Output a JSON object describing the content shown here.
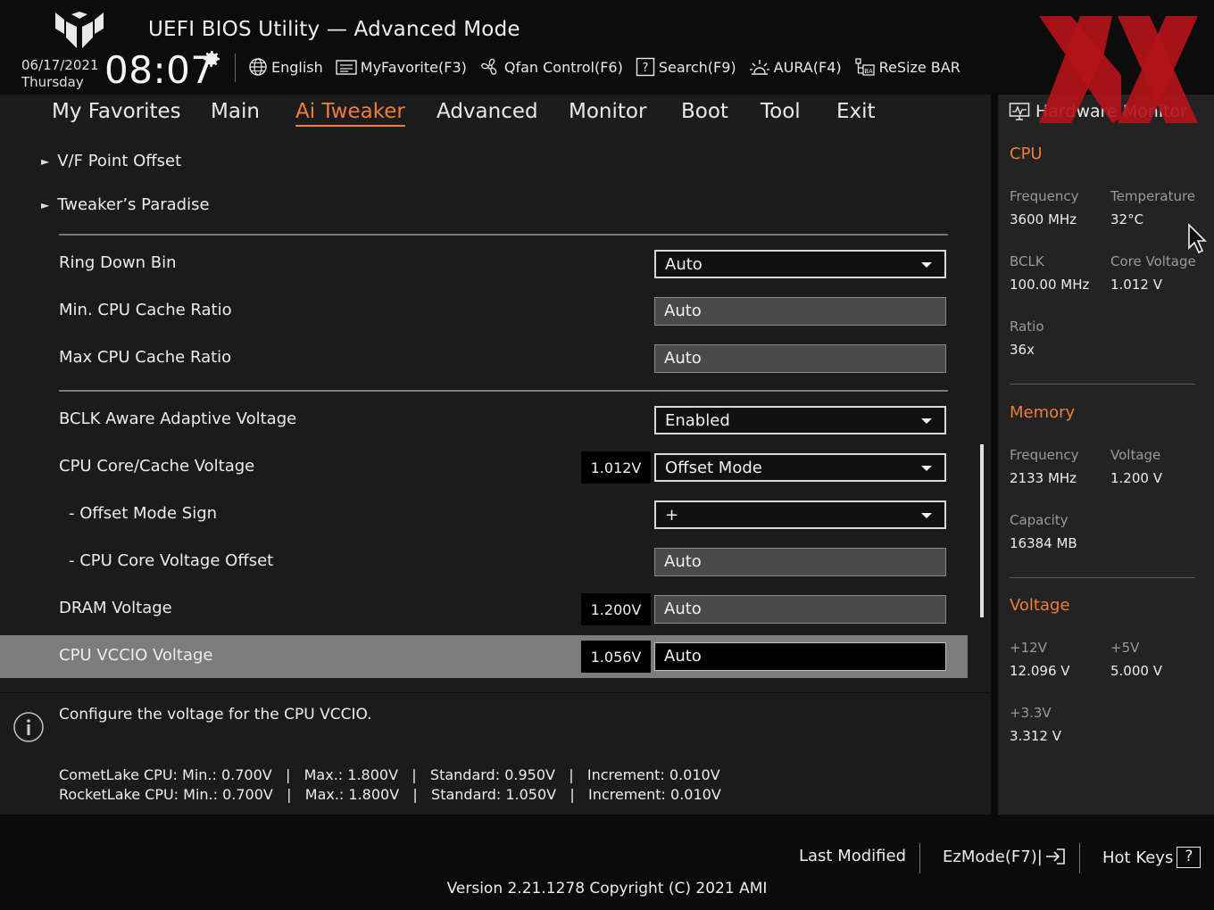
{
  "header": {
    "title": "UEFI BIOS Utility — Advanced Mode",
    "date": "06/17/2021",
    "weekday": "Thursday",
    "time": "08:07",
    "toolbar": {
      "language": "English",
      "my_favorite": "MyFavorite(F3)",
      "qfan": "Qfan Control(F6)",
      "search": "Search(F9)",
      "aura": "AURA(F4)",
      "resize_bar": "ReSize BAR"
    }
  },
  "nav": {
    "tabs": [
      "My Favorites",
      "Main",
      "Ai Tweaker",
      "Advanced",
      "Monitor",
      "Boot",
      "Tool",
      "Exit"
    ],
    "active_tab": "Ai Tweaker"
  },
  "main": {
    "submenus": [
      "V/F Point Offset",
      "Tweaker’s Paradise"
    ],
    "settings": [
      {
        "label": "Ring Down Bin",
        "value": "Auto",
        "kind": "dropdown"
      },
      {
        "label": "Min. CPU Cache Ratio",
        "value": "Auto",
        "kind": "text"
      },
      {
        "label": "Max CPU Cache Ratio",
        "value": "Auto",
        "kind": "text"
      },
      {
        "label": "BCLK Aware Adaptive Voltage",
        "value": "Enabled",
        "kind": "dropdown"
      },
      {
        "label": "CPU Core/Cache Voltage",
        "value": "Offset Mode",
        "kind": "dropdown",
        "reading": "1.012V"
      },
      {
        "label": "- Offset Mode Sign",
        "value": "+",
        "kind": "dropdown"
      },
      {
        "label": "- CPU Core Voltage Offset",
        "value": "Auto",
        "kind": "text"
      },
      {
        "label": "DRAM Voltage",
        "value": "Auto",
        "kind": "text",
        "reading": "1.200V"
      },
      {
        "label": "CPU VCCIO Voltage",
        "value": "Auto",
        "kind": "active",
        "reading": "1.056V",
        "selected": true
      }
    ]
  },
  "help": {
    "title": "Configure the voltage for the CPU VCCIO.",
    "spec_lines": [
      "CometLake CPU: Min.: 0.700V   |   Max.: 1.800V   |   Standard: 0.950V   |   Increment: 0.010V",
      "RocketLake CPU: Min.: 0.700V   |   Max.: 1.800V   |   Standard: 1.050V   |   Increment: 0.010V"
    ]
  },
  "hardware_monitor": {
    "title": "Hardware Monitor",
    "cpu": {
      "section": "CPU",
      "frequency_label": "Frequency",
      "frequency": "3600 MHz",
      "temperature_label": "Temperature",
      "temperature": "32°C",
      "bclk_label": "BCLK",
      "bclk": "100.00 MHz",
      "core_voltage_label": "Core Voltage",
      "core_voltage": "1.012 V",
      "ratio_label": "Ratio",
      "ratio": "36x"
    },
    "memory": {
      "section": "Memory",
      "frequency_label": "Frequency",
      "frequency": "2133 MHz",
      "voltage_label": "Voltage",
      "voltage": "1.200 V",
      "capacity_label": "Capacity",
      "capacity": "16384 MB"
    },
    "voltage": {
      "section": "Voltage",
      "v12_label": "+12V",
      "v12": "12.096 V",
      "v5_label": "+5V",
      "v5": "5.000 V",
      "v33_label": "+3.3V",
      "v33": "3.312 V"
    }
  },
  "footer": {
    "last_modified": "Last Modified",
    "ez_mode": "EzMode(F7)|",
    "hot_keys": "Hot Keys",
    "hot_keys_glyph": "?",
    "version": "Version 2.21.1278 Copyright (C) 2021 AMI"
  },
  "colors": {
    "accent": "#f07d3a",
    "panel": "#1b1b1b",
    "monitor_panel": "#232323",
    "selected_row": "#7c7c7c"
  }
}
